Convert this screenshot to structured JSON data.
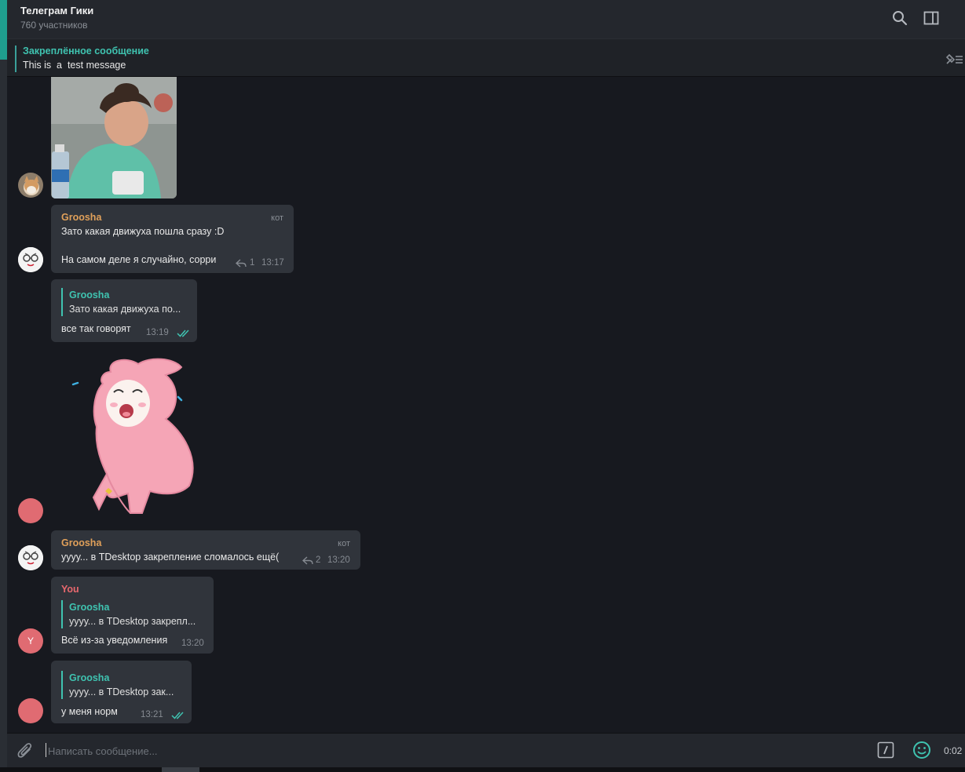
{
  "header": {
    "title": "Телеграм Гики",
    "subtitle": "760 участников"
  },
  "pinned": {
    "title": "Закреплённое сообщение",
    "text": "This is  a  test message"
  },
  "messages": {
    "m1": {
      "sender": "Groosha",
      "tag": "кот",
      "line1": "Зато какая движуха пошла сразу :D",
      "line2": "На самом деле я случайно, сорри",
      "replies": "1",
      "time": "13:17"
    },
    "m2": {
      "quote_name": "Groosha",
      "quote_text": "Зато какая движуха по...",
      "text": "все так говорят",
      "time": "13:19"
    },
    "m3": {
      "sender": "Groosha",
      "tag": "кот",
      "text": "уууу... в TDesktop закрепление сломалось ещё(",
      "replies": "2",
      "time": "13:20"
    },
    "m4": {
      "sender": "You",
      "avatar_letter": "Y",
      "quote_name": "Groosha",
      "quote_text": "уууу... в TDesktop закрепл...",
      "text": "Всё из-за уведомления",
      "time": "13:20"
    },
    "m5": {
      "quote_name": "Groosha",
      "quote_text": "уууу... в TDesktop зак...",
      "text": "у меня норм",
      "time": "13:21"
    }
  },
  "composer": {
    "placeholder": "Написать сообщение...",
    "record_time": "0:02"
  },
  "colors": {
    "accent": "#3fc3b0",
    "sender_orange": "#e0a05a",
    "sender_red": "#e8686e",
    "bubble": "#30343b",
    "background": "#17191f"
  },
  "icons": [
    "search-icon",
    "sidebar-toggle-icon",
    "unpin-icon",
    "reply-icon",
    "double-check-icon",
    "attach-icon",
    "bot-command-icon",
    "emoji-icon"
  ]
}
